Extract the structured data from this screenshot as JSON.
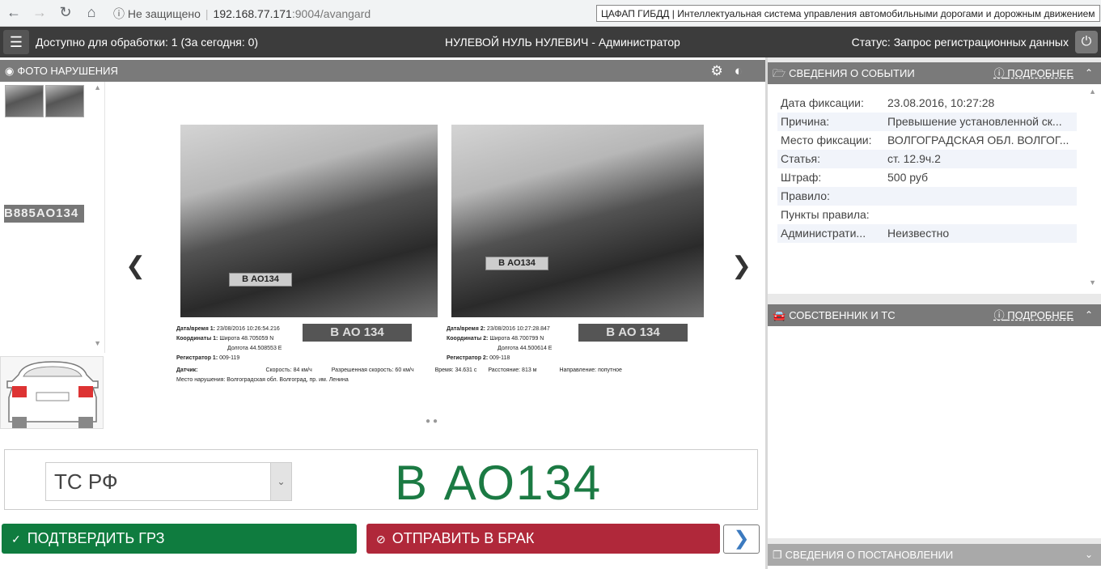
{
  "browser": {
    "not_secure": "Не защищено",
    "host": "192.168.77.171",
    "path": ":9004/avangard",
    "tooltip": "ЦАФАП ГИБДД | Интеллектуальная система управления автомобильными дорогами и дорожным движением"
  },
  "header": {
    "available": "Доступно для обработки: 1 (За сегодня: 0)",
    "user": "НУЛЕВОЙ НУЛЬ НУЛЕВИЧ - Администратор",
    "status": "Статус: Запрос регистрационных данных"
  },
  "photo_panel": {
    "title": "ФОТО НАРУШЕНИЯ",
    "thumb_plate": "В885АО134",
    "photo1_plate": "В   АО134",
    "photo2_plate": "В   АО134",
    "meta1": {
      "datetime_label": "Дата/время 1:",
      "datetime": "23/08/2016 10:26:54.216",
      "coords_label": "Координаты 1:",
      "lat": "Широта 48.705059 N",
      "lon": "Долгота 44.508553 E",
      "registrar_label": "Регистратор 1:",
      "registrar": "009-119",
      "plate": "В   АО 134"
    },
    "meta2": {
      "datetime_label": "Дата/время 2:",
      "datetime": "23/08/2016 10:27:28.847",
      "coords_label": "Координаты 2:",
      "lat": "Широта 48.700799 N",
      "lon": "Долгота 44.500614 E",
      "registrar_label": "Регистратор 2:",
      "registrar": "009-118",
      "plate": "В   АО 134"
    },
    "sensor_line": {
      "sensor_label": "Датчик:",
      "speed": "Скорость: 84 км/ч",
      "allowed_speed": "Разрешенная скорость: 60 км/ч",
      "time": "Время: 34.631 с",
      "distance": "Расстояние: 813 м",
      "direction": "Направление: попутное"
    },
    "place_line": "Место нарушения: Волгоградская обл. Волгоград, пр. им. Ленина"
  },
  "plate_editor": {
    "type_value": "ТС РФ",
    "plate": "В    АО134"
  },
  "actions": {
    "confirm": "ПОДТВЕРДИТЬ ГРЗ",
    "reject": "ОТПРАВИТЬ В БРАК"
  },
  "event": {
    "title": "СВЕДЕНИЯ О СОБЫТИИ",
    "more": "ПОДРОБНЕЕ",
    "rows": [
      {
        "k": "Дата фиксации:",
        "v": "23.08.2016, 10:27:28"
      },
      {
        "k": "Причина:",
        "v": "Превышение установленной ск..."
      },
      {
        "k": "Место фиксации:",
        "v": "ВОЛГОГРАДСКАЯ ОБЛ. ВОЛГОГ..."
      },
      {
        "k": "Статья:",
        "v": "ст. 12.9ч.2"
      },
      {
        "k": "Штраф:",
        "v": "500 руб"
      },
      {
        "k": "Правило:",
        "v": ""
      },
      {
        "k": "Пункты правила:",
        "v": ""
      },
      {
        "k": "Администрати...",
        "v": "Неизвестно"
      }
    ]
  },
  "owner": {
    "title": "СОБСТВЕННИК И ТС",
    "more": "ПОДРОБНЕЕ"
  },
  "resolution": {
    "title": "СВЕДЕНИЯ О ПОСТАНОВЛЕНИИ"
  },
  "colors": {
    "confirm": "#0f7c3f",
    "reject": "#b0283a",
    "plate_text": "#1b7a43"
  }
}
